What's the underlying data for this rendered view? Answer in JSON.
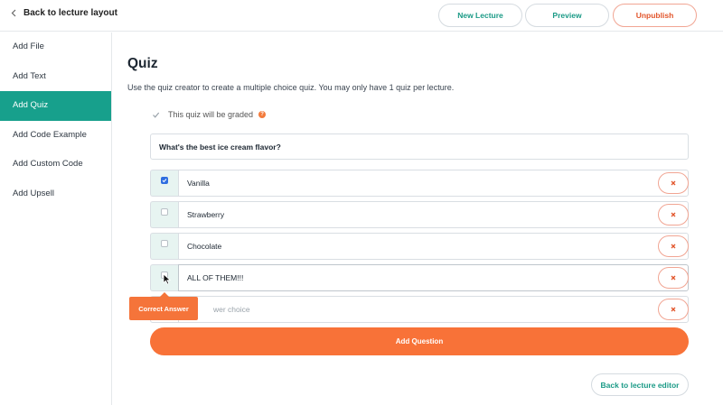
{
  "topbar": {
    "back_label": "Back to lecture layout",
    "new_lecture": "New Lecture",
    "preview": "Preview",
    "unpublish": "Unpublish"
  },
  "sidebar": {
    "items": [
      {
        "label": "Add File",
        "active": false
      },
      {
        "label": "Add Text",
        "active": false
      },
      {
        "label": "Add Quiz",
        "active": true
      },
      {
        "label": "Add Code Example",
        "active": false
      },
      {
        "label": "Add Custom Code",
        "active": false
      },
      {
        "label": "Add Upsell",
        "active": false
      }
    ]
  },
  "quiz": {
    "title": "Quiz",
    "description": "Use the quiz creator to create a multiple choice quiz. You may only have 1 quiz per lecture.",
    "graded_label": "This quiz will be graded",
    "graded_checked": true,
    "question": "What's the best ice cream flavor?",
    "answers": [
      {
        "text": "Vanilla",
        "correct": true
      },
      {
        "text": "Strawberry",
        "correct": false
      },
      {
        "text": "Chocolate",
        "correct": false
      },
      {
        "text": "ALL OF THEM!!!",
        "correct": false
      }
    ],
    "new_answer_placeholder": "Answer choice",
    "new_answer_visible_fragment": "wer choice",
    "tooltip": "Correct Answer",
    "add_question": "Add Question",
    "back_to_editor": "Back to lecture editor"
  },
  "colors": {
    "accent": "#17a08c",
    "orange": "#f87238",
    "check_blue": "#2f6ee0"
  }
}
